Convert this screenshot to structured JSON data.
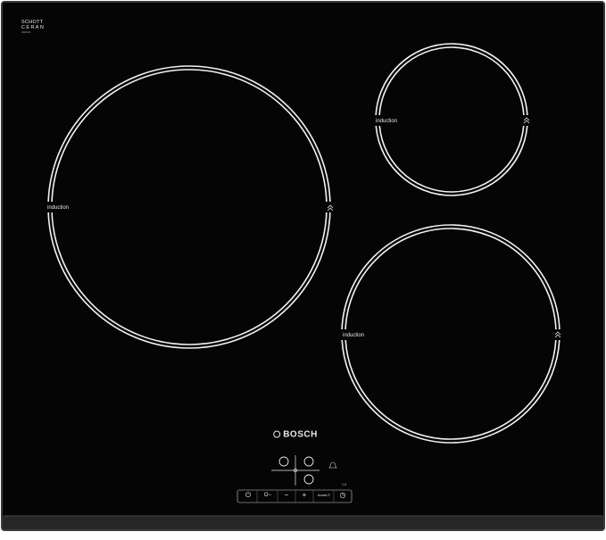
{
  "logo": {
    "line1": "SCHOTT",
    "line2": "CERAN",
    "sub": "CERAN"
  },
  "zones": [
    {
      "id": "large",
      "label": "induction"
    },
    {
      "id": "small",
      "label": "induction"
    },
    {
      "id": "medium",
      "label": "induction"
    }
  ],
  "brand": "BOSCH",
  "controls": {
    "keys": [
      {
        "id": "power",
        "glyph": "⏻"
      },
      {
        "id": "lock",
        "glyph": "O−"
      },
      {
        "id": "minus",
        "glyph": "−"
      },
      {
        "id": "plus",
        "glyph": "+"
      },
      {
        "id": "boost",
        "glyph": "boost ⎍"
      },
      {
        "id": "timer",
        "glyph": "◷"
      }
    ],
    "small_marking": "1.0"
  },
  "colors": {
    "glass": "#050505",
    "frame": "#2e2e2e",
    "ring": "#f2f2f2",
    "print": "#e8e8e8"
  }
}
